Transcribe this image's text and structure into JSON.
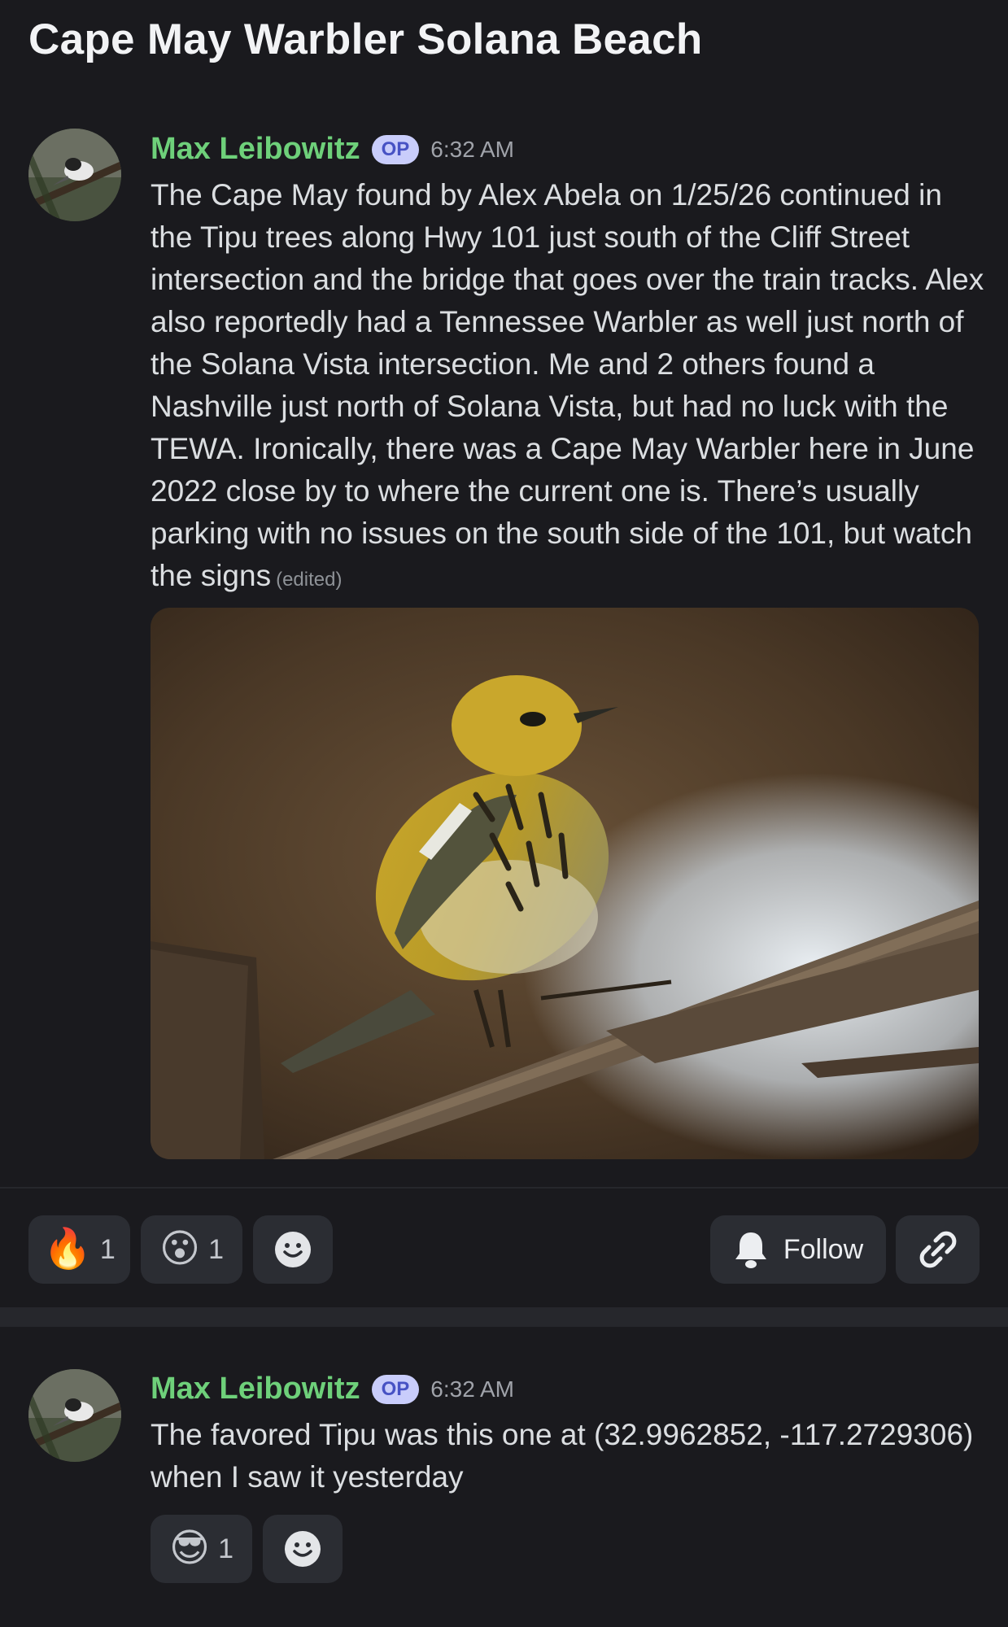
{
  "thread": {
    "title": "Cape May Warbler Solana Beach"
  },
  "messages": [
    {
      "author": "Max Leibowitz",
      "badge": "OP",
      "time": "6:32 AM",
      "text": "The Cape May found by Alex Abela on 1/25/26 continued in the Tipu trees along Hwy 101 just south of the Cliff Street intersection and the bridge that goes over the train tracks. Alex also reportedly had a Tennessee Warbler as well just north of the Solana Vista intersection. Me and 2 others found a Nashville just north of Solana Vista, but had no luck with the TEWA. Ironically, there was a Cape May Warbler here in June 2022 close by to where the current one is. There’s usually parking with no issues on the south side of the 101, but watch the signs",
      "edited_label": "(edited)",
      "reactions": [
        {
          "emoji": "🔥",
          "icon": "fire-emoji",
          "count": "1"
        },
        {
          "emoji": "😮",
          "icon": "surprised-face-emoji",
          "count": "1"
        }
      ]
    },
    {
      "author": "Max Leibowitz",
      "badge": "OP",
      "time": "6:32 AM",
      "text": "The favored Tipu was this one at (32.9962852, -117.2729306) when I saw it yesterday",
      "reactions": [
        {
          "emoji": "😎",
          "icon": "sunglasses-face-emoji",
          "count": "1"
        }
      ]
    }
  ],
  "actions": {
    "follow_label": "Follow"
  },
  "colors": {
    "author": "#6ed07a",
    "op_badge_bg": "#c9cdfb",
    "background": "#1a1a1e"
  }
}
